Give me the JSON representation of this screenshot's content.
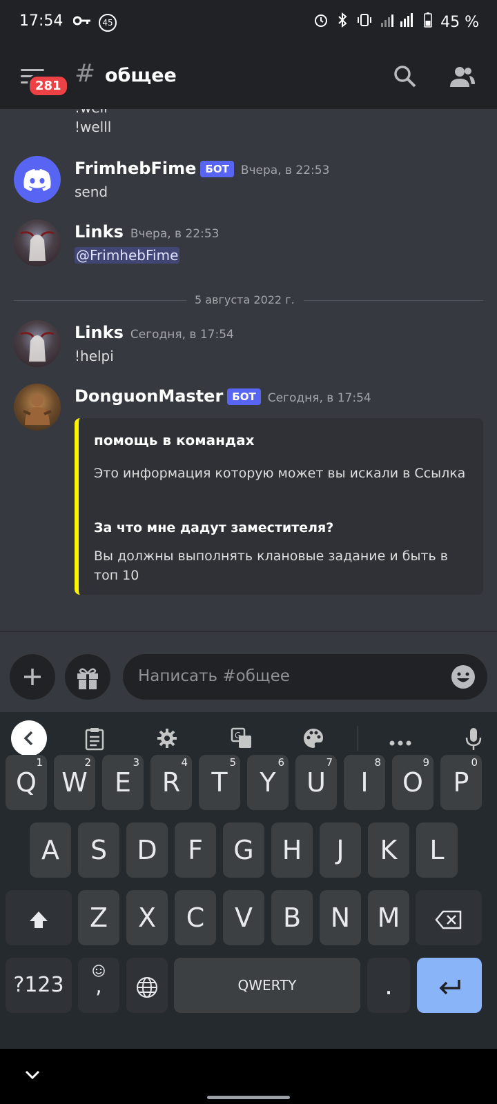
{
  "status_bar": {
    "time": "17:54",
    "notif_count": "45",
    "battery": "45 %",
    "network": "LTE"
  },
  "header": {
    "mention_count": "281",
    "channel_name": "общее"
  },
  "messages": {
    "partial_top": "!well",
    "first_line": "!welll",
    "items": [
      {
        "author": "FrimhebFime",
        "bot_tag": "БОТ",
        "time": "Вчера, в 22:53",
        "text": "send"
      },
      {
        "author": "Links",
        "time": "Вчера, в 22:53",
        "mention": "@FrimhebFime"
      }
    ],
    "date_divider": "5 августа 2022 г.",
    "items_today": [
      {
        "author": "Links",
        "time": "Сегодня, в 17:54",
        "text": "!helpi"
      },
      {
        "author": "DonguonMaster",
        "bot_tag": "БОТ",
        "time": "Сегодня, в 17:54"
      }
    ],
    "embed": {
      "accent_color": "#fcf400",
      "title": "помощь в командах",
      "description": "Это информация которую может вы искали в Ссылка",
      "field_title": "За что мне дадут заместителя?",
      "field_value": "Вы должны выполнять клановые задание и быть в топ 10"
    }
  },
  "composer": {
    "placeholder": "Написать #общее"
  },
  "keyboard": {
    "row1": [
      {
        "label": "Q",
        "hint": "1"
      },
      {
        "label": "W",
        "hint": "2"
      },
      {
        "label": "E",
        "hint": "3"
      },
      {
        "label": "R",
        "hint": "4"
      },
      {
        "label": "T",
        "hint": "5"
      },
      {
        "label": "Y",
        "hint": "6"
      },
      {
        "label": "U",
        "hint": "7"
      },
      {
        "label": "I",
        "hint": "8"
      },
      {
        "label": "O",
        "hint": "9"
      },
      {
        "label": "P",
        "hint": "0"
      }
    ],
    "row2": [
      "A",
      "S",
      "D",
      "F",
      "G",
      "H",
      "J",
      "K",
      "L"
    ],
    "row3": [
      "Z",
      "X",
      "C",
      "V",
      "B",
      "N",
      "M"
    ],
    "symbols_label": "?123",
    "comma_label": ",",
    "space_label": "QWERTY",
    "period_label": ".",
    "enter_color": "#8ab4f8"
  },
  "colors": {
    "background": "#36393f",
    "header": "#202225",
    "bot_tag": "#5865f2",
    "badge": "#ed4245"
  }
}
